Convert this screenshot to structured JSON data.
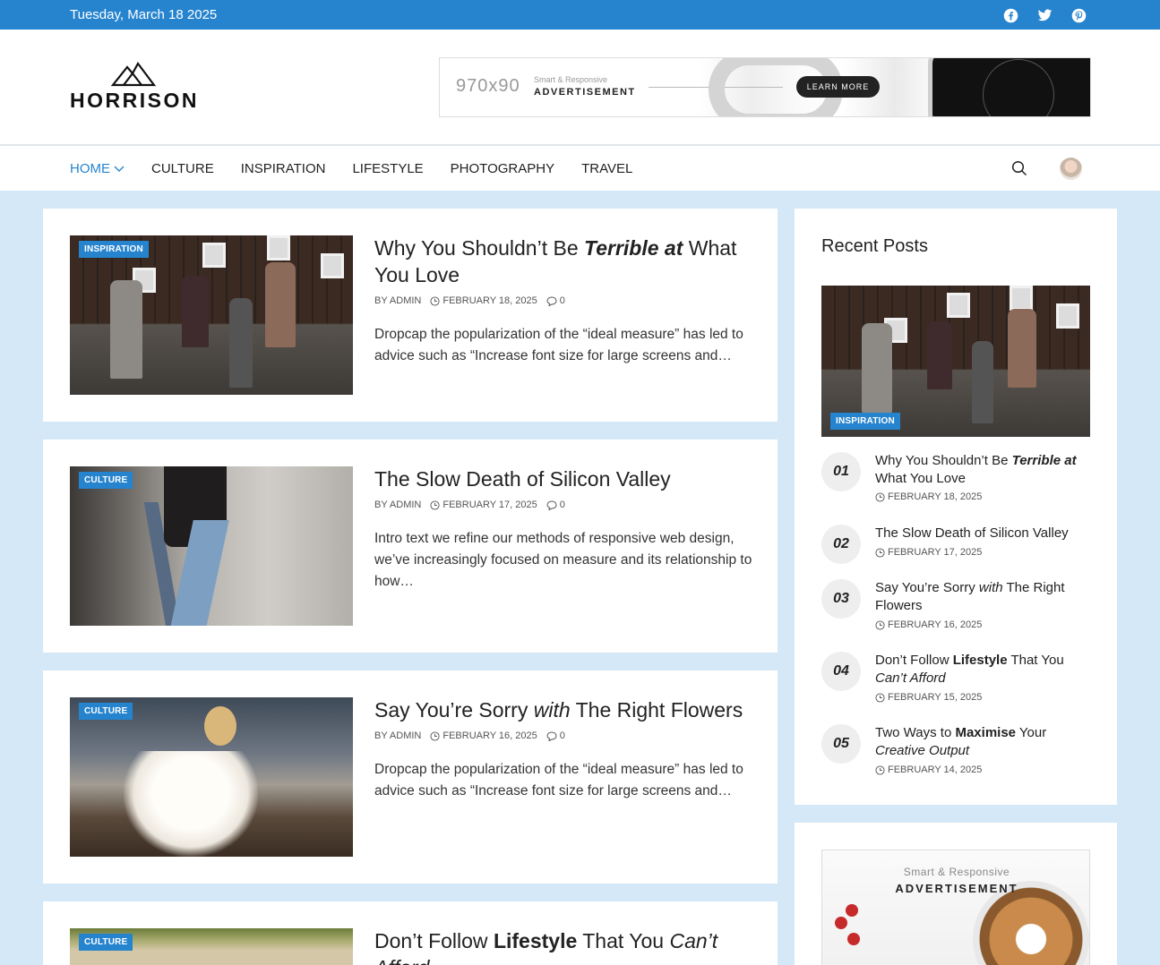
{
  "topbar": {
    "date": "Tuesday, March 18 2025",
    "social": [
      "facebook-icon",
      "twitter-icon",
      "pinterest-icon"
    ]
  },
  "logo": {
    "text": "HORRISON"
  },
  "ad_banner": {
    "size": "970x90",
    "smart": "Smart & Responsive",
    "advertisement": "ADVERTISEMENT",
    "button": "LEARN MORE"
  },
  "nav": {
    "items": [
      "HOME",
      "CULTURE",
      "INSPIRATION",
      "LIFESTYLE",
      "PHOTOGRAPHY",
      "TRAVEL"
    ],
    "active": "HOME"
  },
  "posts": [
    {
      "category": "INSPIRATION",
      "title_parts": [
        "Why You Shouldn’t Be ",
        "Terrible at",
        " What You Love"
      ],
      "author": "BY ADMIN",
      "date": "FEBRUARY 18, 2025",
      "comments": "0",
      "excerpt": "Dropcap the popularization of the “ideal measure” has led to advice such as “Increase font size for large screens and…"
    },
    {
      "category": "CULTURE",
      "title": "The Slow Death of Silicon Valley",
      "author": "BY ADMIN",
      "date": "FEBRUARY 17, 2025",
      "comments": "0",
      "excerpt": "Intro text we refine our methods of responsive web design, we’ve increasingly focused on measure and its relationship to how…"
    },
    {
      "category": "CULTURE",
      "title_parts": [
        "Say You’re Sorry ",
        "with",
        " The Right Flowers"
      ],
      "author": "BY ADMIN",
      "date": "FEBRUARY 16, 2025",
      "comments": "0",
      "excerpt": "Dropcap the popularization of the “ideal measure” has led to advice such as “Increase font size for large screens and…"
    },
    {
      "category": "CULTURE",
      "title_parts": [
        "Don’t Follow ",
        "Lifestyle",
        " That You ",
        "Can’t",
        "Afford"
      ]
    }
  ],
  "sidebar": {
    "recent_title": "Recent Posts",
    "featured_category": "INSPIRATION",
    "recent": [
      {
        "num": "01",
        "title_parts": [
          "Why You Shouldn’t Be ",
          "Terrible at",
          " What You Love"
        ],
        "date": "FEBRUARY 18, 2025"
      },
      {
        "num": "02",
        "title": "The Slow Death of Silicon Valley",
        "date": "FEBRUARY 17, 2025"
      },
      {
        "num": "03",
        "title_parts": [
          "Say You’re Sorry ",
          "with",
          " The Right Flowers"
        ],
        "date": "FEBRUARY 16, 2025"
      },
      {
        "num": "04",
        "title_parts": [
          "Don’t Follow ",
          "Lifestyle",
          " That You ",
          "Can’t Afford"
        ],
        "date": "FEBRUARY 15, 2025"
      },
      {
        "num": "05",
        "title_parts": [
          "Two Ways to ",
          "Maximise",
          " Your ",
          "Creative Output"
        ],
        "date": "FEBRUARY 14, 2025"
      }
    ],
    "ad": {
      "smart": "Smart & Responsive",
      "advertisement": "ADVERTISEMENT"
    }
  },
  "colors": {
    "accent": "#2684cf",
    "page_bg": "#d4e8f7"
  }
}
